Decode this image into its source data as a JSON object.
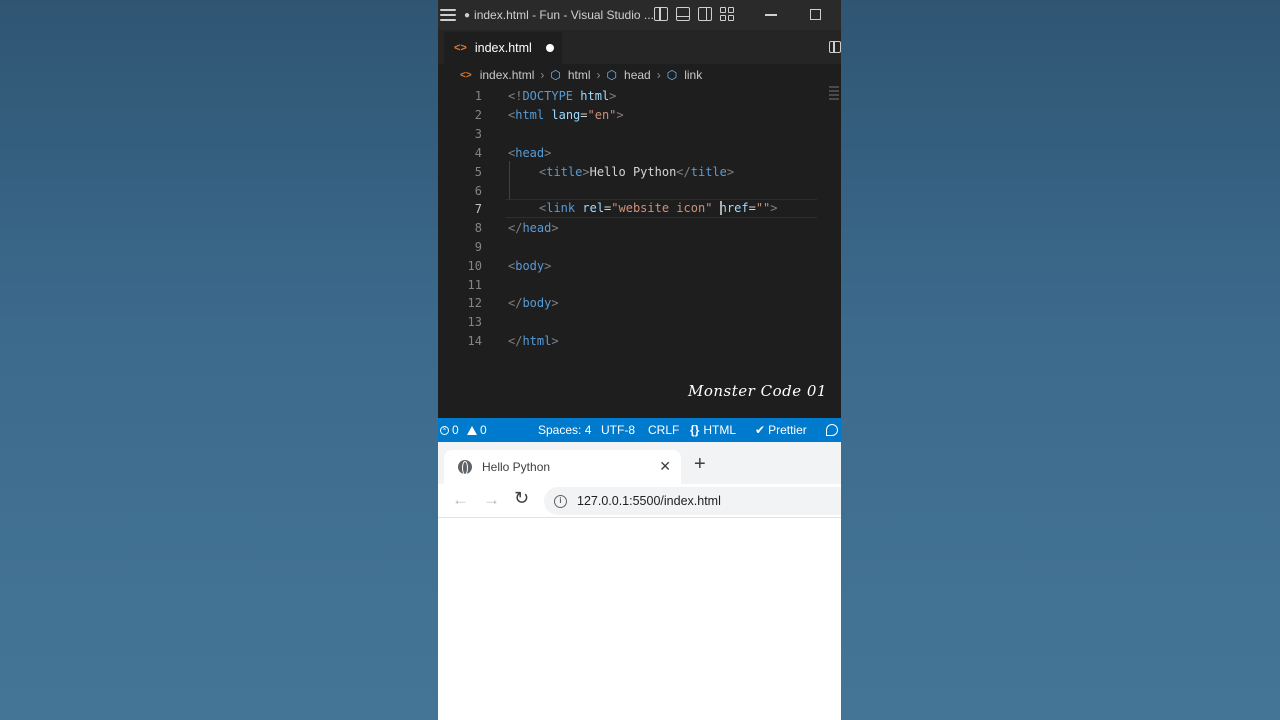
{
  "window": {
    "title": "index.html - Fun - Visual Studio ..."
  },
  "editor_tab": {
    "filename": "index.html"
  },
  "breadcrumb": {
    "file": "index.html",
    "items": [
      "html",
      "head",
      "link"
    ]
  },
  "code": {
    "line_numbers": [
      "1",
      "2",
      "3",
      "4",
      "5",
      "6",
      "7",
      "8",
      "9",
      "10",
      "11",
      "12",
      "13",
      "14"
    ],
    "active_line": 7,
    "lines": {
      "l1": {
        "open": "<!",
        "kw": "DOCTYPE",
        "sp": " ",
        "name": "html",
        "close": ">"
      },
      "l2": {
        "open": "<",
        "tag": "html",
        "attr": " lang",
        "eq": "=",
        "val": "\"en\"",
        "close": ">"
      },
      "l4": {
        "open": "<",
        "tag": "head",
        "close": ">"
      },
      "l5": {
        "open": "<",
        "tag": "title",
        "close": ">",
        "text": "Hello Python",
        "open2": "</",
        "tag2": "title",
        "close2": ">"
      },
      "l7": {
        "open": "<",
        "tag": "link",
        "attr1": " rel",
        "eq1": "=",
        "val1": "\"website icon\"",
        "sp": " ",
        "attr2a": "h",
        "attr2b": "ref",
        "eq2": "=",
        "val2": "\"\"",
        "close": ">"
      },
      "l8": {
        "open": "</",
        "tag": "head",
        "close": ">"
      },
      "l10": {
        "open": "<",
        "tag": "body",
        "close": ">"
      },
      "l12": {
        "open": "</",
        "tag": "body",
        "close": ">"
      },
      "l14": {
        "open": "</",
        "tag": "html",
        "close": ">"
      }
    }
  },
  "watermark": "Monster Code 01",
  "statusbar": {
    "errors": "0",
    "warnings": "0",
    "spaces": "Spaces: 4",
    "encoding": "UTF-8",
    "eol": "CRLF",
    "language": "HTML",
    "formatter": "Prettier"
  },
  "browser": {
    "tab_title": "Hello Python",
    "new_tab": "+",
    "close": "✕",
    "url": "127.0.0.1:5500/index.html"
  },
  "colors": {
    "status_bar": "#007acc",
    "editor_bg": "#1e1e1e",
    "tag": "#569cd6",
    "attribute": "#9cdcfe",
    "string": "#ce9178"
  }
}
